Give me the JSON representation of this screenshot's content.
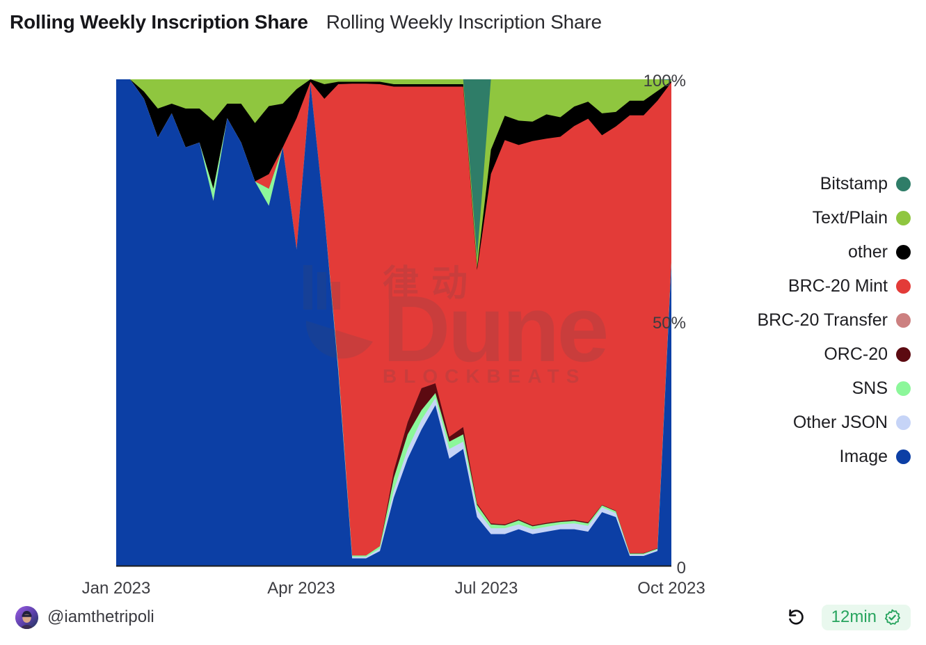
{
  "header": {
    "title": "Rolling Weekly Inscription Share",
    "subtitle": "Rolling Weekly Inscription Share"
  },
  "watermark": {
    "brand": "Dune",
    "secondary": "BLOCKBEATS",
    "cn": "律动"
  },
  "footer": {
    "handle": "@iamthetripoli",
    "freshness": "12min",
    "refresh_icon": "refresh-icon",
    "verified_icon": "verified-badge-icon",
    "avatar": "user-avatar"
  },
  "legend": {
    "items": [
      {
        "label": "Bitstamp",
        "color": "#2f7d68"
      },
      {
        "label": "Text/Plain",
        "color": "#8fc63f"
      },
      {
        "label": "other",
        "color": "#000000"
      },
      {
        "label": "BRC-20 Mint",
        "color": "#e33b38"
      },
      {
        "label": "BRC-20 Transfer",
        "color": "#cc8080"
      },
      {
        "label": "ORC-20",
        "color": "#5c0a11"
      },
      {
        "label": "SNS",
        "color": "#8cf79a"
      },
      {
        "label": "Other JSON",
        "color": "#c6d4f7"
      },
      {
        "label": "Image",
        "color": "#0c3fa5"
      }
    ]
  },
  "chart_data": {
    "type": "area",
    "stacked": true,
    "normalized": true,
    "title": "Rolling Weekly Inscription Share",
    "xlabel": "",
    "ylabel": "",
    "ylim": [
      0,
      100
    ],
    "grid": false,
    "legend_position": "right",
    "y_ticks": [
      "0",
      "50%",
      "100%"
    ],
    "y_tick_values": [
      0,
      50,
      100
    ],
    "x_ticks": [
      "Jan 2023",
      "Apr 2023",
      "Jul 2023",
      "Oct 2023"
    ],
    "x_tick_positions": [
      0.0,
      0.3333,
      0.6667,
      1.0
    ],
    "x": [
      "2023-01-01",
      "2023-01-08",
      "2023-01-15",
      "2023-01-22",
      "2023-01-29",
      "2023-02-05",
      "2023-02-12",
      "2023-02-19",
      "2023-02-26",
      "2023-03-05",
      "2023-03-12",
      "2023-03-19",
      "2023-03-26",
      "2023-04-02",
      "2023-04-09",
      "2023-04-16",
      "2023-04-23",
      "2023-04-30",
      "2023-05-07",
      "2023-05-14",
      "2023-05-21",
      "2023-05-28",
      "2023-06-04",
      "2023-06-11",
      "2023-06-18",
      "2023-06-25",
      "2023-07-02",
      "2023-07-09",
      "2023-07-16",
      "2023-07-23",
      "2023-07-30",
      "2023-08-06",
      "2023-08-13",
      "2023-08-20",
      "2023-08-27",
      "2023-09-03",
      "2023-09-10",
      "2023-09-17",
      "2023-09-24",
      "2023-10-01",
      "2023-10-08"
    ],
    "series": [
      {
        "name": "Image",
        "color": "#0c3fa5",
        "values": [
          100,
          100,
          96,
          88,
          93,
          86,
          87,
          75,
          92,
          87,
          79,
          74,
          86,
          65,
          99,
          72,
          40,
          1.5,
          1.5,
          3,
          14,
          22,
          28,
          33,
          22,
          24,
          10,
          6.5,
          6.5,
          7.5,
          6.5,
          7,
          7.5,
          7.5,
          7,
          11,
          10,
          2,
          2,
          3,
          62
        ]
      },
      {
        "name": "Other JSON",
        "color": "#c6d4f7",
        "values": [
          0,
          0,
          0,
          0,
          0,
          0,
          0,
          0,
          0,
          0,
          0,
          0,
          0,
          0,
          0,
          0,
          0.5,
          0.3,
          0.3,
          0.5,
          1.5,
          2,
          2,
          1.5,
          2,
          1.5,
          1.5,
          1.2,
          1.2,
          1,
          1,
          1,
          1,
          1.2,
          1.2,
          1,
          0.8,
          0.3,
          0.3,
          0.3,
          0.3
        ]
      },
      {
        "name": "SNS",
        "color": "#8cf79a",
        "values": [
          0,
          0,
          0,
          0,
          0,
          0,
          0,
          2.5,
          0,
          0,
          0,
          3.5,
          0,
          0,
          0,
          0,
          0.5,
          0.3,
          0.3,
          0.5,
          2.5,
          3,
          2,
          1,
          1.5,
          1.5,
          1,
          0.8,
          0.6,
          0.8,
          0.6,
          0.6,
          0.5,
          0.5,
          0.5,
          0.4,
          0.4,
          0.2,
          0.2,
          0.2,
          0.2
        ]
      },
      {
        "name": "ORC-20",
        "color": "#5c0a11",
        "values": [
          0,
          0,
          0,
          0,
          0,
          0,
          0,
          0,
          0,
          0,
          0,
          0,
          0,
          0,
          0,
          0,
          0,
          0,
          0,
          0,
          1.5,
          2.5,
          4.5,
          2,
          1,
          1.5,
          0.3,
          0.2,
          0.2,
          0.2,
          0.2,
          0.2,
          0.2,
          0.2,
          0.2,
          0.1,
          0.1,
          0.1,
          0.1,
          0.1,
          0.1
        ]
      },
      {
        "name": "BRC-20 Transfer",
        "color": "#cc8080",
        "values": [
          0,
          0,
          0,
          0,
          0,
          0,
          0,
          0,
          0,
          0,
          0,
          0,
          0,
          0,
          0,
          0,
          0,
          0,
          0,
          0,
          0,
          0,
          0,
          0,
          0,
          0,
          0,
          0,
          0,
          0,
          0,
          0,
          0,
          0,
          0,
          0,
          0,
          0,
          0,
          0,
          0
        ]
      },
      {
        "name": "BRC-20 Mint",
        "color": "#e33b38",
        "values": [
          0,
          0,
          0,
          0,
          0,
          0,
          0,
          0,
          0,
          0,
          0,
          3,
          0,
          27,
          0.5,
          24,
          58,
          97,
          97,
          95,
          79,
          69,
          62,
          61,
          72,
          70,
          48,
          72,
          79,
          77,
          79,
          79,
          79,
          81,
          83,
          76,
          79,
          90,
          90,
          92,
          37
        ]
      },
      {
        "name": "other",
        "color": "#000000",
        "values": [
          0,
          0,
          1.5,
          6,
          2,
          8,
          7,
          14,
          3,
          8,
          12,
          14,
          9,
          6,
          0.5,
          3,
          0.5,
          0.4,
          0.4,
          0.5,
          0.5,
          0.5,
          0.5,
          0.5,
          0.5,
          0.5,
          0.5,
          5,
          5,
          5,
          4,
          5,
          4,
          4,
          3.5,
          4.5,
          3,
          3,
          3,
          2,
          0.2
        ]
      },
      {
        "name": "Text/Plain",
        "color": "#8fc63f",
        "values": [
          0,
          0,
          2.5,
          6,
          5,
          6,
          6,
          8.5,
          5,
          5,
          9,
          5.5,
          5,
          2,
          0,
          1,
          0.5,
          0.5,
          0.5,
          0.5,
          1,
          1,
          1,
          1,
          1,
          1,
          2,
          14.5,
          7.5,
          8.5,
          8.7,
          7.2,
          7.8,
          5.6,
          4.6,
          7,
          6.7,
          4.4,
          4.4,
          2.4,
          0.2
        ]
      },
      {
        "name": "Bitstamp",
        "color": "#2f7d68",
        "values": [
          0,
          0,
          0,
          0,
          0,
          0,
          0,
          0,
          0,
          0,
          0,
          0,
          0,
          0,
          0,
          0,
          0,
          0,
          0,
          0,
          0,
          0,
          0,
          0,
          0,
          0,
          36.7,
          0,
          0,
          0,
          0,
          0,
          0,
          0,
          0,
          0,
          0,
          0,
          0,
          0,
          0.2
        ]
      }
    ]
  }
}
